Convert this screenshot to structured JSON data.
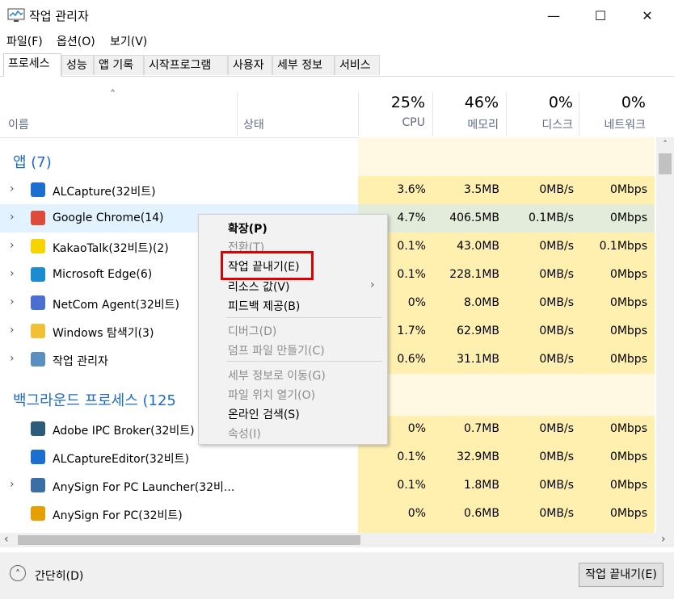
{
  "window": {
    "title": "작업 관리자",
    "minimize": "—",
    "maximize": "☐",
    "close": "✕"
  },
  "menu": [
    "파일(F)",
    "옵션(O)",
    "보기(V)"
  ],
  "tabs": [
    "프로세스",
    "성능",
    "앱 기록",
    "시작프로그램",
    "사용자",
    "세부 정보",
    "서비스"
  ],
  "columns": {
    "sort_arrow": "˄",
    "name": "이름",
    "status": "상태",
    "cpu": {
      "pct": "25%",
      "label": "CPU"
    },
    "memory": {
      "pct": "46%",
      "label": "메모리"
    },
    "disk": {
      "pct": "0%",
      "label": "디스크"
    },
    "network": {
      "pct": "0%",
      "label": "네트워크"
    }
  },
  "groups": {
    "apps": "앱 (7)",
    "background": "백그라운드 프로세스 (125"
  },
  "apps": [
    {
      "name": "ALCapture(32비트)",
      "cpu": "3.6%",
      "mem": "3.5MB",
      "disk": "0MB/s",
      "net": "0Mbps",
      "icon": "alcapture-icon",
      "color": "#1a6fd1"
    },
    {
      "name": "Google Chrome(14)",
      "cpu": "4.7%",
      "mem": "406.5MB",
      "disk": "0.1MB/s",
      "net": "0Mbps",
      "icon": "chrome-icon",
      "color": "#dd4b39"
    },
    {
      "name": "KakaoTalk(32비트)(2)",
      "cpu": "0.1%",
      "mem": "43.0MB",
      "disk": "0MB/s",
      "net": "0.1Mbps",
      "icon": "kakaotalk-icon",
      "color": "#f7d400"
    },
    {
      "name": "Microsoft Edge(6)",
      "cpu": "0.1%",
      "mem": "228.1MB",
      "disk": "0MB/s",
      "net": "0Mbps",
      "icon": "edge-icon",
      "color": "#1b8bd2"
    },
    {
      "name": "NetCom Agent(32비트)",
      "cpu": "0%",
      "mem": "8.0MB",
      "disk": "0MB/s",
      "net": "0Mbps",
      "icon": "netcom-icon",
      "color": "#4b6fd1"
    },
    {
      "name": "Windows 탐색기(3)",
      "cpu": "1.7%",
      "mem": "62.9MB",
      "disk": "0MB/s",
      "net": "0Mbps",
      "icon": "explorer-icon",
      "color": "#f2c035"
    },
    {
      "name": "작업 관리자",
      "cpu": "0.6%",
      "mem": "31.1MB",
      "disk": "0MB/s",
      "net": "0Mbps",
      "icon": "taskmgr-icon",
      "color": "#5a8fbf"
    }
  ],
  "background": [
    {
      "name": "Adobe IPC Broker(32비트)",
      "cpu": "0%",
      "mem": "0.7MB",
      "disk": "0MB/s",
      "net": "0Mbps",
      "icon": "adobe-icon",
      "color": "#2e5b7a",
      "expand": false
    },
    {
      "name": "ALCaptureEditor(32비트)",
      "cpu": "0.1%",
      "mem": "32.9MB",
      "disk": "0MB/s",
      "net": "0Mbps",
      "icon": "alcapture-icon",
      "color": "#1a6fd1",
      "expand": false
    },
    {
      "name": "AnySign For PC Launcher(32비...",
      "cpu": "0.1%",
      "mem": "1.8MB",
      "disk": "0MB/s",
      "net": "0Mbps",
      "icon": "anysign-launcher-icon",
      "color": "#3a6ea5",
      "expand": true
    },
    {
      "name": "AnySign For PC(32비트)",
      "cpu": "0%",
      "mem": "0.6MB",
      "disk": "0MB/s",
      "net": "0Mbps",
      "icon": "anysign-icon",
      "color": "#e5a000",
      "expand": false
    }
  ],
  "context_menu": [
    {
      "label": "확장(P)",
      "bold": true,
      "disabled": false
    },
    {
      "label": "전환(T)",
      "disabled": true
    },
    {
      "label": "작업 끝내기(E)",
      "disabled": false
    },
    {
      "label": "리소스 값(V)",
      "disabled": false,
      "submenu": "›"
    },
    {
      "label": "피드백 제공(B)",
      "disabled": false
    },
    {
      "label": "디버그(D)",
      "disabled": true
    },
    {
      "label": "덤프 파일 만들기(C)",
      "disabled": true
    },
    {
      "label": "세부 정보로 이동(G)",
      "disabled": true
    },
    {
      "label": "파일 위치 열기(O)",
      "disabled": true
    },
    {
      "label": "온라인 검색(S)",
      "disabled": false
    },
    {
      "label": "속성(I)",
      "disabled": true
    }
  ],
  "footer": {
    "simple_label": "간단히(D)",
    "simple_glyph": "˄",
    "end_task": "작업 끝내기(E)"
  },
  "scroll": {
    "up": "˄",
    "left": "‹",
    "right": "›"
  }
}
